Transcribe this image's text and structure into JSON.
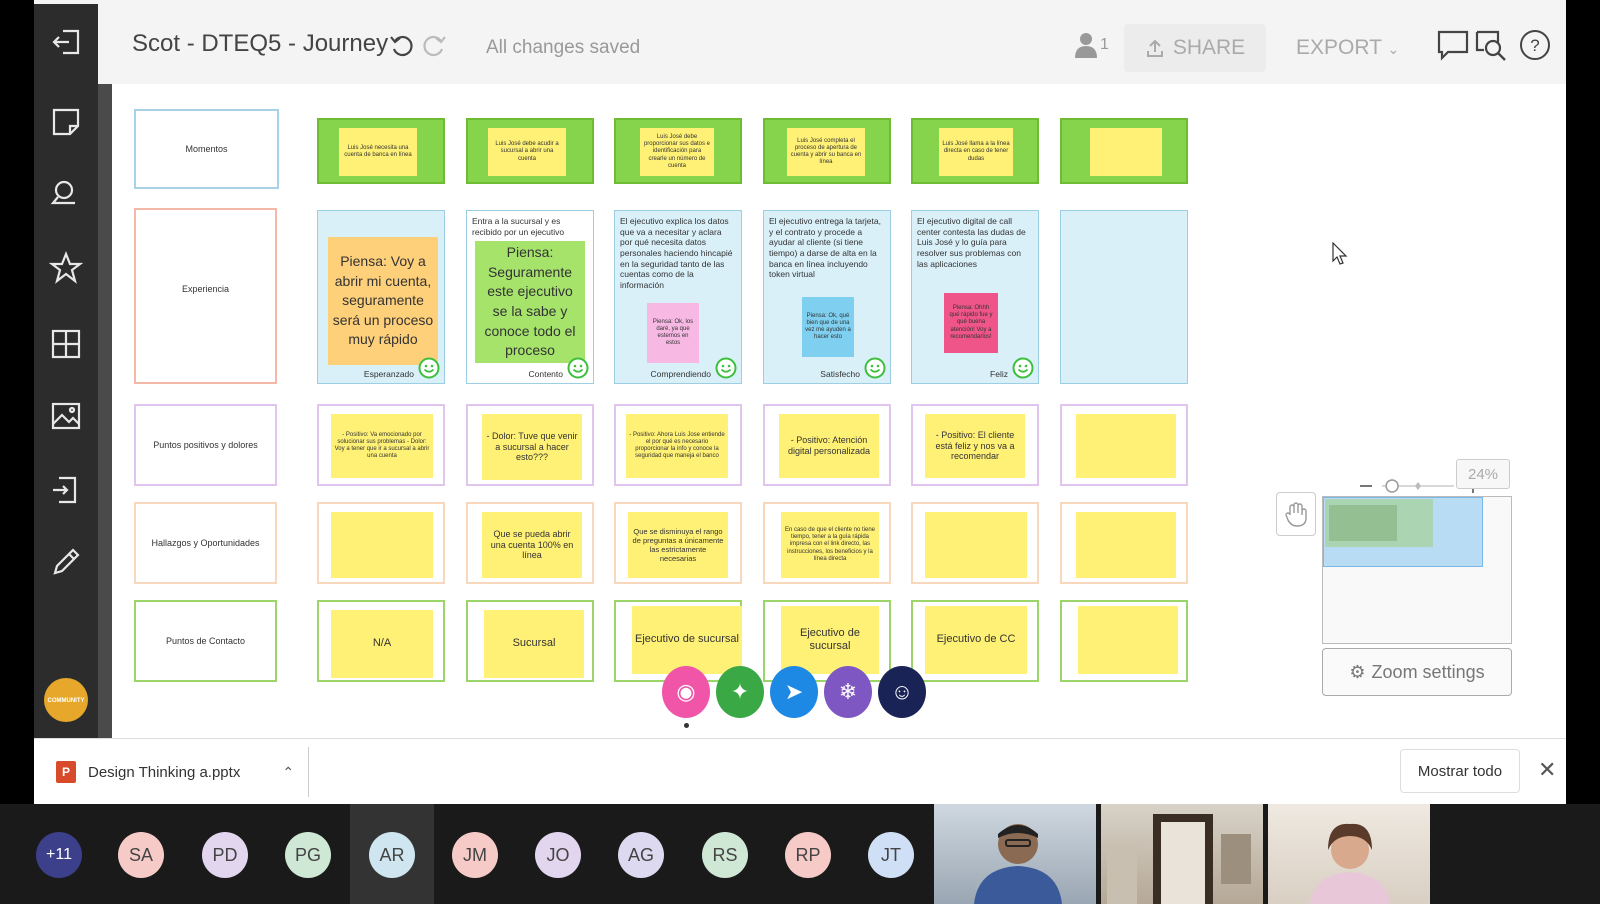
{
  "app": {
    "title": "Scot - DTEQ5 - Journey",
    "save_status": "All changes saved",
    "collaborators_count": "1",
    "share_label": "SHARE",
    "export_label": "EXPORT"
  },
  "sidebar": {
    "items": [
      "exit-icon",
      "sticky-note-icon",
      "search-board-icon",
      "star-icon",
      "grid-icon",
      "image-icon",
      "import-icon",
      "pencil-icon"
    ],
    "logo_text": "COMMUNITY"
  },
  "board": {
    "rows": {
      "momentos": "Momentos",
      "experiencia": "Experiencia",
      "puntos": "Puntos positivos y dolores",
      "hallazgos": "Hallazgos y Oportunidades",
      "contacto": "Puntos de Contacto"
    },
    "momentos": [
      "Luis José necesita una cuenta de banca en línea",
      "Luis José debe acudir a sucursal a abrir una cuenta",
      "Luis José debe proporcionar sus datos e identificación para crearle un número de cuenta",
      "Luis José completa el proceso de apertura de cuenta y abrir su banca en línea",
      "Luis José llama a la línea directa en caso de tener dudas",
      ""
    ],
    "experiencia": [
      {
        "text": "",
        "note": "Piensa: Voy a abrir mi cuenta, seguramente será un proceso muy rápido",
        "label": "Esperanzado"
      },
      {
        "text": "Entra a la sucursal y es recibido por un ejecutivo",
        "note": "Piensa: Seguramente este ejecutivo se la sabe y conoce todo el proceso",
        "label": "Contento"
      },
      {
        "text": "El ejecutivo explica los datos que va a necesitar y aclara por qué necesita datos personales haciendo hincapié en la seguridad tanto de las cuentas como de la información",
        "note": "Piensa: Ok, los daré, ya que estemos en estos",
        "label": "Comprendiendo"
      },
      {
        "text": "El ejecutivo entrega la tarjeta, y el contrato y procede a ayudar al cliente (si tiene tiempo) a darse de alta en la banca en línea incluyendo token virtual",
        "note": "Piensa: Ok, qué bien que de una vez me ayuden a hacer esto",
        "label": "Satisfecho"
      },
      {
        "text": "El ejecutivo digital de call center contesta las dudas de Luis José y lo guía para resolver sus problemas con las aplicaciones",
        "note": "Piensa: Ohhh qué rápido fue y qué buena atención! Voy a recomendarlos!",
        "label": "Feliz"
      }
    ],
    "puntos": [
      "- Positivo: Va emocionado por solucionar sus problemas - Dolor: Voy a tener que ir a sucursal a abrir una cuenta",
      "- Dolor: Tuve que venir a sucursal a hacer esto???",
      "- Positivo: Ahora Luis Jose entiende el por qué es necesario proporcionar la info y conoce la seguridad que maneja el banco",
      "- Positivo: Atención digital personalizada",
      "- Positivo: El cliente está feliz y nos va a recomendar",
      ""
    ],
    "hallazgos": [
      "",
      "Que se pueda abrir una cuenta 100% en línea",
      "Que se disminuya el rango de preguntas a únicamente las estrictamente necesarias",
      "En caso de que el cliente no tiene tiempo, tener a la guía rápida impresa con el link directo, las instrucciones, los beneficios y la línea directa",
      "",
      ""
    ],
    "contacto": [
      "N/A",
      "Sucursal",
      "Ejecutivo de sucursal",
      "Ejecutivo de sucursal",
      "Ejecutivo de CC",
      ""
    ]
  },
  "zoom": {
    "percent": "24%",
    "level": 0.24,
    "settings_label": "Zoom settings"
  },
  "download_bar": {
    "file_name": "Design Thinking a.pptx",
    "show_all": "Mostrar todo"
  },
  "participants": {
    "more": "+11",
    "initials": [
      "SA",
      "PD",
      "PG",
      "AR",
      "JM",
      "JO",
      "AG",
      "RS",
      "RP",
      "JT"
    ]
  },
  "colors": {
    "green_header": "#86d44b",
    "sticky_yellow": "#fff176",
    "exp_blue": "#d9f0f9",
    "sidebar": "#2c2c2c"
  }
}
